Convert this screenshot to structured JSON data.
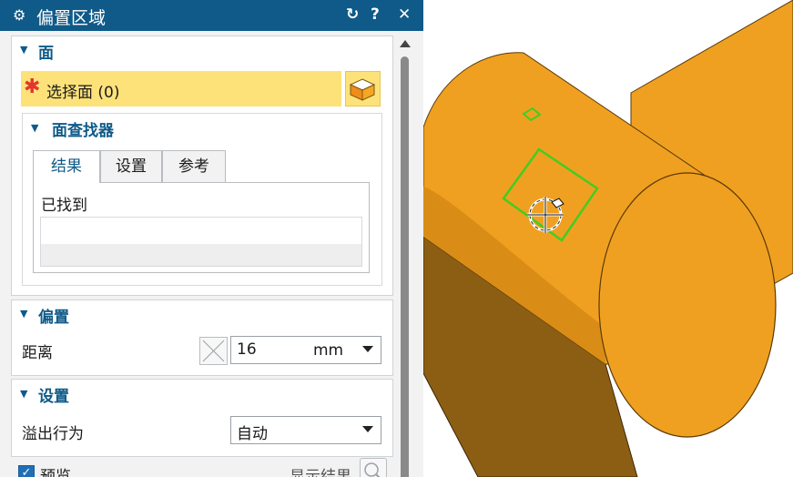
{
  "window": {
    "title": "偏置区域",
    "buttons": {
      "reset": "↻",
      "help": "?",
      "close": "✕"
    }
  },
  "face_section": {
    "title": "面",
    "select_label": "选择面 (0)",
    "finder": {
      "title": "面查找器",
      "tabs": [
        "结果",
        "设置",
        "参考"
      ],
      "active_tab": "结果",
      "found_label": "已找到"
    }
  },
  "offset_section": {
    "title": "偏置",
    "distance_label": "距离",
    "distance_value": "16",
    "distance_unit": "mm"
  },
  "settings_section": {
    "title": "设置",
    "overflow_label": "溢出行为",
    "overflow_value": "自动"
  },
  "footer": {
    "preview_label": "预览",
    "preview_checked": true,
    "show_result_label": "显示结果"
  },
  "colors": {
    "titlebar": "#0f5a88",
    "accent_text": "#0f5a88",
    "selection_highlight": "#fde27a",
    "required_star": "#e3362f",
    "model_orange": "#f0a020",
    "selection_outline": "#44cc22"
  },
  "icons": [
    "gear-icon",
    "reset-icon",
    "help-icon",
    "close-icon",
    "required-star-icon",
    "face-select-icon",
    "distance-toggle-icon",
    "show-result-icon",
    "checkbox-check-icon",
    "crosshair-cursor-icon"
  ]
}
